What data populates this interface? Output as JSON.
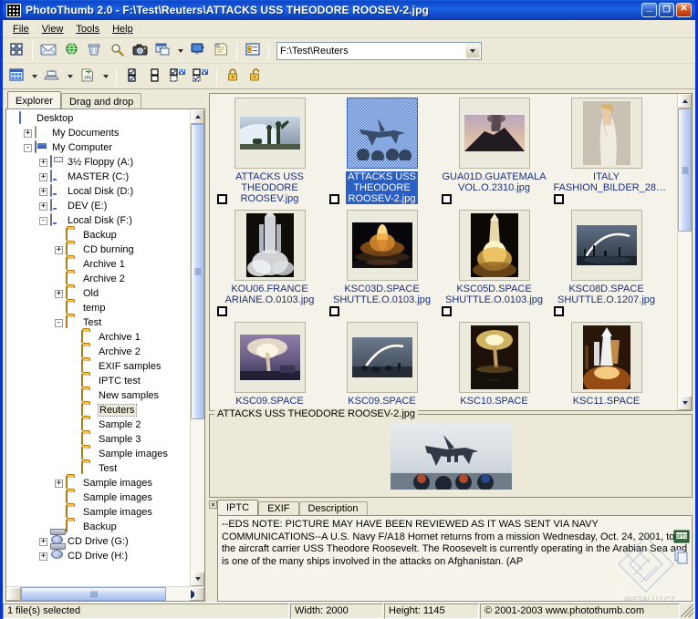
{
  "window": {
    "title": "PhotoThumb 2.0  -  F:\\Test\\Reuters\\ATTACKS USS THEODORE ROOSEV-2.jpg",
    "app_icon": "grid-app-icon",
    "minimize_label": "_",
    "maximize_label": "❐",
    "close_label": "✕",
    "titlebar_color": "#0d47c8"
  },
  "menu": {
    "items": [
      {
        "label": "File"
      },
      {
        "label": "View"
      },
      {
        "label": "Tools"
      },
      {
        "label": "Help"
      }
    ]
  },
  "toolbar_top": {
    "buttons": [
      {
        "name": "thumbnails-icon"
      },
      {
        "name": "mail-icon"
      },
      {
        "name": "globe-icon"
      },
      {
        "name": "trash-icon"
      },
      {
        "name": "magnifier-icon"
      },
      {
        "name": "camera-icon"
      },
      {
        "name": "batch-date-icon"
      },
      {
        "name": "dropdown-caret-icon"
      },
      {
        "name": "slideshow-monitor-icon"
      },
      {
        "name": "notes-icon"
      },
      {
        "name": "properties-icon"
      }
    ],
    "address": {
      "value": "F:\\Test\\Reuters",
      "placeholder": "",
      "dropdown_icon": "chevron-down-icon"
    }
  },
  "toolbar_bottom": {
    "buttons": [
      {
        "name": "view-mode-icon"
      },
      {
        "name": "view-mode-caret-icon"
      },
      {
        "name": "scan-import-icon"
      },
      {
        "name": "scan-import-caret-icon"
      },
      {
        "name": "convert-jpg-icon",
        "text": "JPG"
      },
      {
        "name": "convert-jpg-caret-icon"
      },
      {
        "name": "select-all-icon"
      },
      {
        "name": "select-none-icon"
      },
      {
        "name": "invert-selection-icon"
      },
      {
        "name": "select-inverse-icon"
      },
      {
        "name": "lock-closed-icon"
      },
      {
        "name": "lock-open-icon"
      }
    ]
  },
  "left_panel": {
    "tabs": [
      {
        "label": "Explorer",
        "active": true
      },
      {
        "label": "Drag and drop",
        "active": false
      }
    ],
    "tree": [
      {
        "label": "Desktop",
        "indent": 0,
        "expander": "",
        "icon": "desktop-icon",
        "selected": false
      },
      {
        "label": "My Documents",
        "indent": 1,
        "expander": "+",
        "icon": "documents-icon",
        "selected": false
      },
      {
        "label": "My Computer",
        "indent": 1,
        "expander": "-",
        "icon": "computer-icon",
        "selected": false
      },
      {
        "label": "3½ Floppy (A:)",
        "indent": 2,
        "expander": "+",
        "icon": "floppy-icon",
        "selected": false
      },
      {
        "label": "MASTER (C:)",
        "indent": 2,
        "expander": "+",
        "icon": "drive-icon",
        "selected": false
      },
      {
        "label": "Local Disk (D:)",
        "indent": 2,
        "expander": "+",
        "icon": "drive-icon",
        "selected": false
      },
      {
        "label": "DEV (E:)",
        "indent": 2,
        "expander": "+",
        "icon": "drive-icon",
        "selected": false
      },
      {
        "label": "Local Disk (F:)",
        "indent": 2,
        "expander": "-",
        "icon": "drive-icon",
        "selected": false
      },
      {
        "label": "Backup",
        "indent": 3,
        "expander": "",
        "icon": "folder-icon",
        "selected": false
      },
      {
        "label": "CD burning",
        "indent": 3,
        "expander": "+",
        "icon": "folder-icon",
        "selected": false
      },
      {
        "label": "Archive 1",
        "indent": 3,
        "expander": "",
        "icon": "folder-icon",
        "selected": false
      },
      {
        "label": "Archive 2",
        "indent": 3,
        "expander": "",
        "icon": "folder-icon",
        "selected": false
      },
      {
        "label": "Old",
        "indent": 3,
        "expander": "+",
        "icon": "folder-icon",
        "selected": false
      },
      {
        "label": "temp",
        "indent": 3,
        "expander": "",
        "icon": "folder-icon",
        "selected": false
      },
      {
        "label": "Test",
        "indent": 3,
        "expander": "-",
        "icon": "folder-icon",
        "selected": false
      },
      {
        "label": "Archive 1",
        "indent": 4,
        "expander": "",
        "icon": "folder-icon",
        "selected": false
      },
      {
        "label": "Archive 2",
        "indent": 4,
        "expander": "",
        "icon": "folder-icon",
        "selected": false
      },
      {
        "label": "EXIF samples",
        "indent": 4,
        "expander": "",
        "icon": "folder-icon",
        "selected": false
      },
      {
        "label": "IPTC test",
        "indent": 4,
        "expander": "",
        "icon": "folder-icon",
        "selected": false
      },
      {
        "label": "New samples",
        "indent": 4,
        "expander": "",
        "icon": "folder-icon",
        "selected": false
      },
      {
        "label": "Reuters",
        "indent": 4,
        "expander": "",
        "icon": "folder-icon",
        "selected": true
      },
      {
        "label": "Sample 2",
        "indent": 4,
        "expander": "",
        "icon": "folder-icon",
        "selected": false
      },
      {
        "label": "Sample 3",
        "indent": 4,
        "expander": "",
        "icon": "folder-icon",
        "selected": false
      },
      {
        "label": "Sample images",
        "indent": 4,
        "expander": "",
        "icon": "folder-icon",
        "selected": false
      },
      {
        "label": "Test",
        "indent": 4,
        "expander": "",
        "icon": "folder-icon",
        "selected": false
      },
      {
        "label": "Sample images",
        "indent": 3,
        "expander": "+",
        "icon": "folder-icon",
        "selected": false
      },
      {
        "label": "Sample images",
        "indent": 3,
        "expander": "",
        "icon": "folder-icon",
        "selected": false
      },
      {
        "label": "Sample images",
        "indent": 3,
        "expander": "",
        "icon": "folder-icon",
        "selected": false
      },
      {
        "label": "Backup",
        "indent": 3,
        "expander": "",
        "icon": "folder-icon",
        "selected": false
      },
      {
        "label": "CD Drive (G:)",
        "indent": 2,
        "expander": "+",
        "icon": "cd-icon",
        "selected": false
      },
      {
        "label": "CD Drive (H:)",
        "indent": 2,
        "expander": "+",
        "icon": "cd-icon",
        "selected": false
      }
    ]
  },
  "thumbnails": {
    "items": [
      {
        "caption": "ATTACKS USS\nTHEODORE ROOSEV.jpg",
        "selected": false,
        "image": "soldiers-snow"
      },
      {
        "caption": "ATTACKS USS\nTHEODORE\nROOSEV-2.jpg",
        "selected": true,
        "image": "fighter-jet"
      },
      {
        "caption": "GUA01D.GUATEMALA\nVOL.O.2310.jpg",
        "selected": false,
        "image": "volcano"
      },
      {
        "caption": "ITALY\nFASHION_BILDER_28…",
        "selected": false,
        "image": "fashion-model"
      },
      {
        "caption": "KOU06.FRANCE\nARIANE.O.0103.jpg",
        "selected": false,
        "image": "ariane-rocket"
      },
      {
        "caption": "KSC03D.SPACE\nSHUTTLE.O.0103.jpg",
        "selected": false,
        "image": "shuttle-night-launch"
      },
      {
        "caption": "KSC05D.SPACE\nSHUTTLE.O.0103.jpg",
        "selected": false,
        "image": "shuttle-liftoff"
      },
      {
        "caption": "KSC08D.SPACE\nSHUTTLE.O.1207.jpg",
        "selected": false,
        "image": "shuttle-arc-trail"
      },
      {
        "caption": "KSC09.SPACE",
        "selected": false,
        "image": "shuttle-storm"
      },
      {
        "caption": "KSC09.SPACE",
        "selected": false,
        "image": "shuttle-trail-dusk"
      },
      {
        "caption": "KSC10.SPACE",
        "selected": false,
        "image": "shuttle-pad-glow"
      },
      {
        "caption": "KSC11.SPACE",
        "selected": false,
        "image": "shuttle-on-pad"
      }
    ]
  },
  "preview": {
    "title": "ATTACKS USS THEODORE ROOSEV-2.jpg",
    "image": "fighter-jet-landing"
  },
  "info_tabs": {
    "close_label": "×",
    "tabs": [
      {
        "label": "IPTC",
        "active": true
      },
      {
        "label": "EXIF",
        "active": false
      },
      {
        "label": "Description",
        "active": false
      }
    ],
    "text": "--EDS NOTE: PICTURE MAY HAVE BEEN REVIEWED AS IT WAS SENT VIA NAVY COMMUNICATIONS--A U.S. Navy F/A18 Hornet returns from a mission Wednesday, Oct. 24, 2001, to the aircraft carrier USS Theodore Roosevelt.  The Roosevelt is currently operating in the Arabian Sea and  is one of the many ships involved in the attacks on  Afghanistan.  (AP",
    "watermark": "INSTALUJ.CZ",
    "side_buttons": [
      {
        "name": "iptc-export-icon",
        "text": "IPTC"
      },
      {
        "name": "copy-icon"
      }
    ]
  },
  "statusbar": {
    "selection": "1 file(s) selected",
    "width": "Width: 2000",
    "height": "Height: 1145",
    "copyright": "© 2001-2003 www.photothumb.com"
  }
}
